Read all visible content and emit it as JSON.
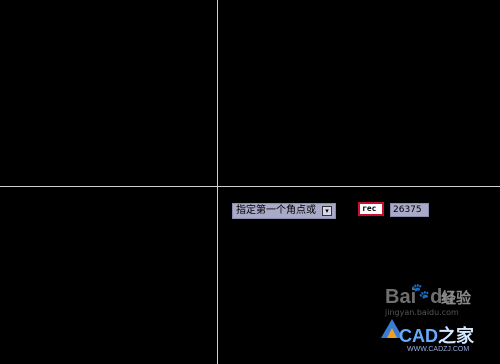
{
  "viewport": {
    "crosshair_color": "#cfcfcf",
    "background_color": "#000000"
  },
  "dynamic_input": {
    "prompt_text": "指定第一个角点或",
    "dropdown_icon": "down-arrow-icon",
    "command_value": "rec",
    "coordinate_value": "26375"
  },
  "watermark": {
    "brand1": "Bai",
    "brand1_suffix": "du",
    "brand2": "经验",
    "sub": "jingyan.baidu.com",
    "cad_brand": "CAD之家",
    "cad_prefix": "CAD",
    "cad_suffix": "之家",
    "url": "WWW.CADZJ.COM"
  }
}
